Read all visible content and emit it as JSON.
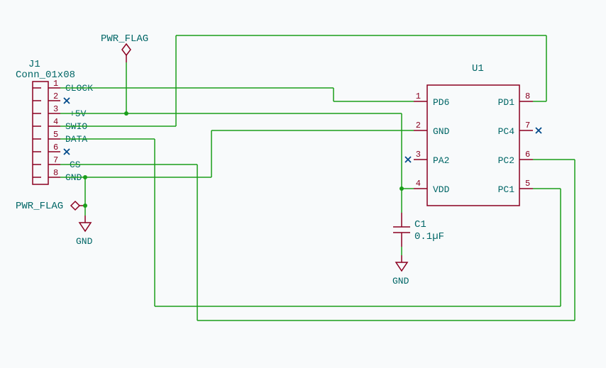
{
  "connector": {
    "ref": "J1",
    "value": "Conn_01x08",
    "pins": [
      {
        "num": "1",
        "net": "CLOCK"
      },
      {
        "num": "2",
        "net": ""
      },
      {
        "num": "3",
        "net": "+5V"
      },
      {
        "num": "4",
        "net": "SWIO"
      },
      {
        "num": "5",
        "net": "DATA"
      },
      {
        "num": "6",
        "net": ""
      },
      {
        "num": "7",
        "net": "CS"
      },
      {
        "num": "8",
        "net": "GND"
      }
    ]
  },
  "ic": {
    "ref": "U1",
    "left": [
      {
        "num": "1",
        "name": "PD6"
      },
      {
        "num": "2",
        "name": "GND"
      },
      {
        "num": "3",
        "name": "PA2"
      },
      {
        "num": "4",
        "name": "VDD"
      }
    ],
    "right": [
      {
        "num": "8",
        "name": "PD1"
      },
      {
        "num": "7",
        "name": "PC4"
      },
      {
        "num": "6",
        "name": "PC2"
      },
      {
        "num": "5",
        "name": "PC1"
      }
    ]
  },
  "cap": {
    "ref": "C1",
    "value": "0.1µF"
  },
  "power": {
    "pwr_flag": "PWR_FLAG",
    "gnd": "GND"
  }
}
